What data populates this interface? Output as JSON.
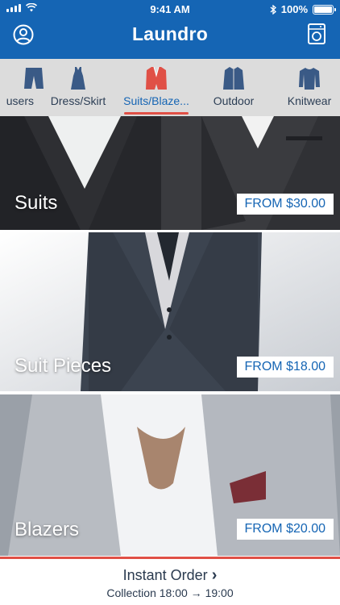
{
  "status_bar": {
    "time": "9:41 AM",
    "battery": "100%",
    "battery_level": 1.0
  },
  "header": {
    "title": "Laundro",
    "profile_icon": "profile-icon",
    "washer_icon": "washing-machine-icon"
  },
  "tabs": [
    {
      "label": "Trousers",
      "visible_label": "users",
      "icon": "trousers-icon"
    },
    {
      "label": "Dress/Skirt",
      "icon": "dress-icon"
    },
    {
      "label": "Suits/Blaze...",
      "icon": "blazer-icon",
      "active": true
    },
    {
      "label": "Outdoor",
      "icon": "jacket-icon"
    },
    {
      "label": "Knitwear",
      "icon": "sweater-icon"
    }
  ],
  "colors": {
    "brand_blue": "#1565b4",
    "accent_red": "#e05046",
    "tab_bg": "#dcdcdc",
    "active_icon": "#e05046"
  },
  "products": [
    {
      "name": "Suits",
      "price": "FROM $30.00"
    },
    {
      "name": "Suit Pieces",
      "price": "FROM $18.00"
    },
    {
      "name": "Blazers",
      "price": "FROM $20.00"
    }
  ],
  "footer": {
    "title": "Instant Order",
    "arrow": "›",
    "subtitle": "Collection 18:00 → 19:00"
  }
}
